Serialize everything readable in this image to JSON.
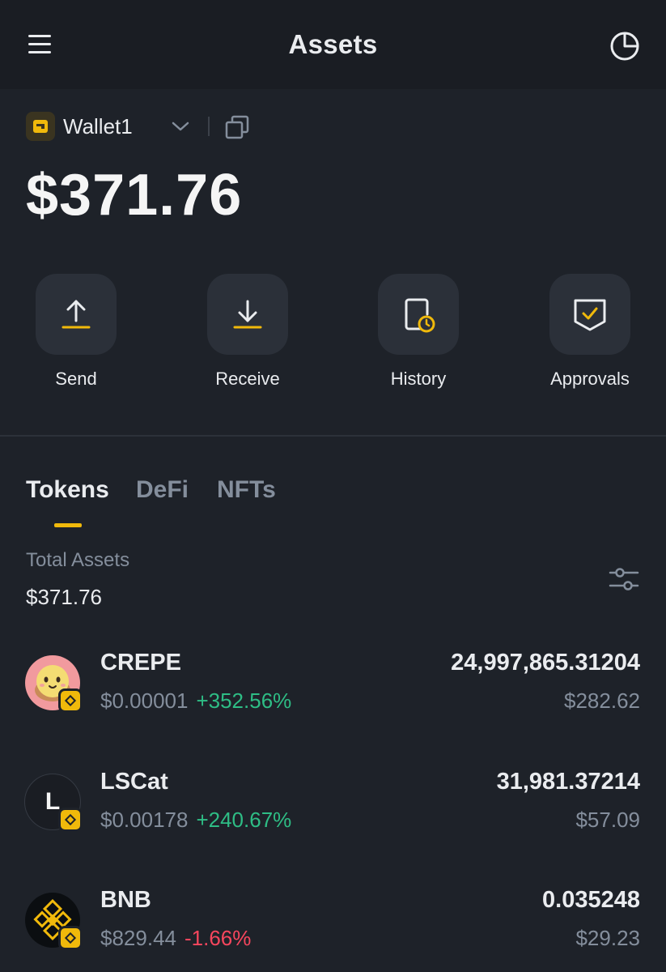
{
  "header": {
    "title": "Assets",
    "menu_icon": "hamburger-icon",
    "right_icon": "pie-chart-icon"
  },
  "wallet": {
    "name": "Wallet1",
    "balance": "$371.76"
  },
  "actions": [
    {
      "label": "Send",
      "icon": "upload-arrow-icon"
    },
    {
      "label": "Receive",
      "icon": "download-arrow-icon"
    },
    {
      "label": "History",
      "icon": "history-clock-icon"
    },
    {
      "label": "Approvals",
      "icon": "shield-check-icon"
    }
  ],
  "tabs": [
    {
      "label": "Tokens",
      "active": true
    },
    {
      "label": "DeFi",
      "active": false
    },
    {
      "label": "NFTs",
      "active": false
    }
  ],
  "total": {
    "label": "Total Assets",
    "value": "$371.76"
  },
  "tokens": [
    {
      "symbol": "CREPE",
      "price": "$0.00001",
      "change": "+352.56%",
      "direction": "up",
      "amount": "24,997,865.31204",
      "value": "$282.62",
      "logo_letter": ""
    },
    {
      "symbol": "LSCat",
      "price": "$0.00178",
      "change": "+240.67%",
      "direction": "up",
      "amount": "31,981.37214",
      "value": "$57.09",
      "logo_letter": "L"
    },
    {
      "symbol": "BNB",
      "price": "$829.44",
      "change": "-1.66%",
      "direction": "down",
      "amount": "0.035248",
      "value": "$29.23",
      "logo_letter": ""
    }
  ],
  "colors": {
    "accent": "#f0b90b",
    "up": "#2ebd85",
    "down": "#f6465d",
    "background": "#1e2229",
    "header": "#1a1d23",
    "tile": "#2b3039",
    "muted": "#848e9c"
  }
}
